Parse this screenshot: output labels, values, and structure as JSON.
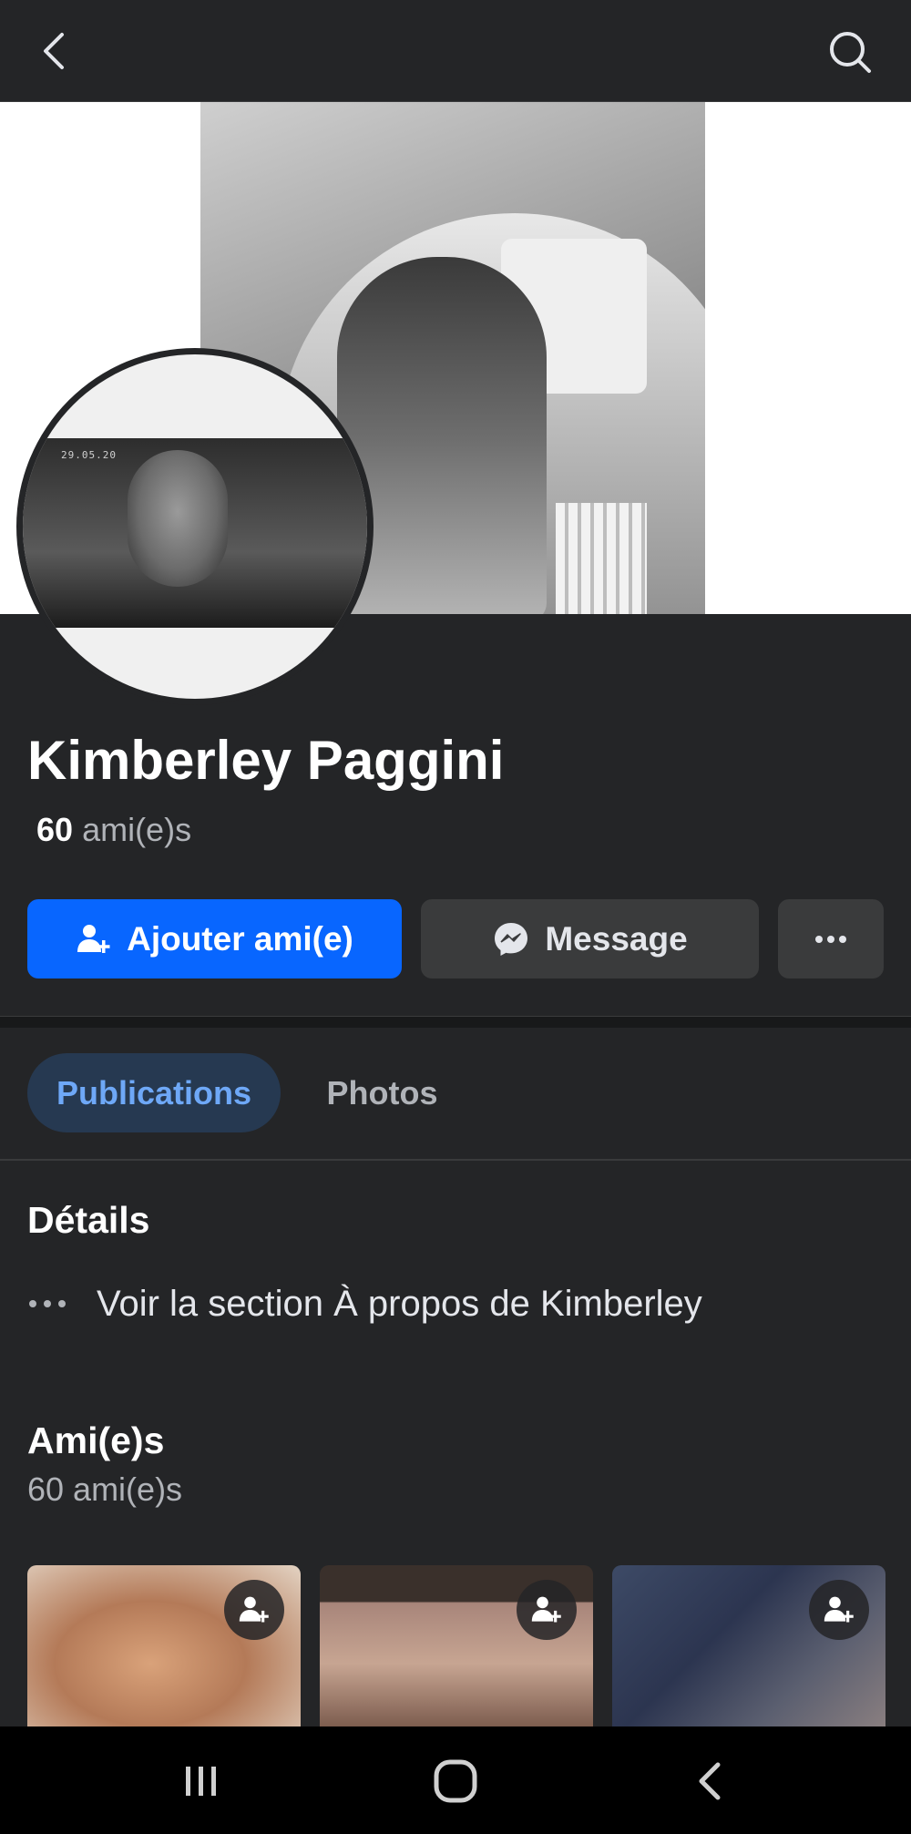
{
  "profile": {
    "name": "Kimberley Paggini",
    "friends_count_number": "60",
    "friends_count_suffix": "ami(e)s",
    "avatar_timestamp": "29.05.20"
  },
  "actions": {
    "add_friend": "Ajouter ami(e)",
    "message": "Message",
    "more": "···"
  },
  "tabs": [
    {
      "label": "Publications",
      "active": true
    },
    {
      "label": "Photos",
      "active": false
    }
  ],
  "details": {
    "title": "Détails",
    "about_link": "Voir la section À propos de Kimberley"
  },
  "friends": {
    "title": "Ami(e)s",
    "subtitle": "60 ami(e)s"
  },
  "colors": {
    "accent": "#0866ff",
    "background": "#242527",
    "tab_active_bg": "#263951",
    "tab_active_text": "#6ea8f7"
  },
  "icons": [
    "back-arrow-icon",
    "search-icon",
    "add-friend-icon",
    "messenger-icon",
    "more-icon",
    "recents-icon",
    "home-icon",
    "nav-back-icon"
  ]
}
